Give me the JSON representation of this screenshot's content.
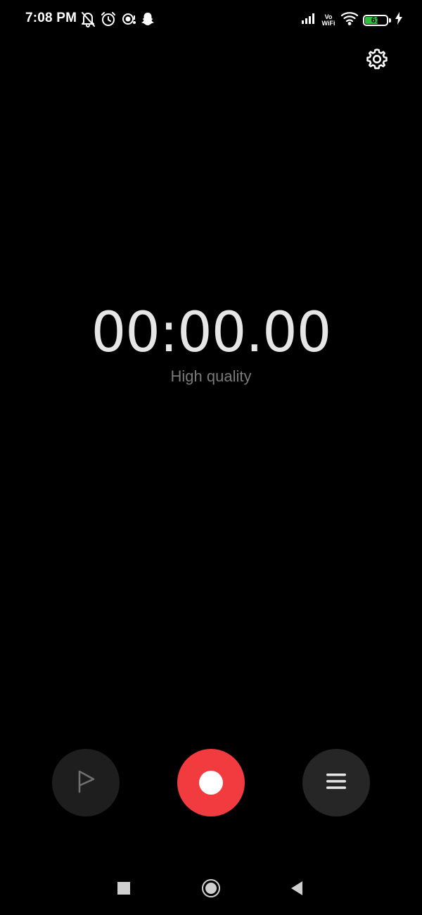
{
  "status_bar": {
    "time": "7:08 PM",
    "left_icons": [
      "bell-off-icon",
      "alarm-clock-icon",
      "app-notification-icon",
      "snapchat-icon"
    ],
    "right_icons": [
      "signal-icon",
      "vowifi-icon",
      "wifi-icon",
      "battery-icon",
      "charging-icon"
    ],
    "vowifi_top": "Vo",
    "vowifi_bottom": "WiFi",
    "battery_level": "61",
    "battery_percent": 61
  },
  "header": {
    "settings_icon": "gear-icon"
  },
  "recorder": {
    "timer": "00:00.00",
    "quality": "High quality"
  },
  "controls": {
    "play_icon": "play-outline-icon",
    "record_icon": "record-dot-icon",
    "list_icon": "menu-list-icon",
    "record_color": "#f13b3e"
  },
  "nav_bar": {
    "icons": [
      "square-recents-icon",
      "circle-home-icon",
      "triangle-back-icon"
    ]
  }
}
